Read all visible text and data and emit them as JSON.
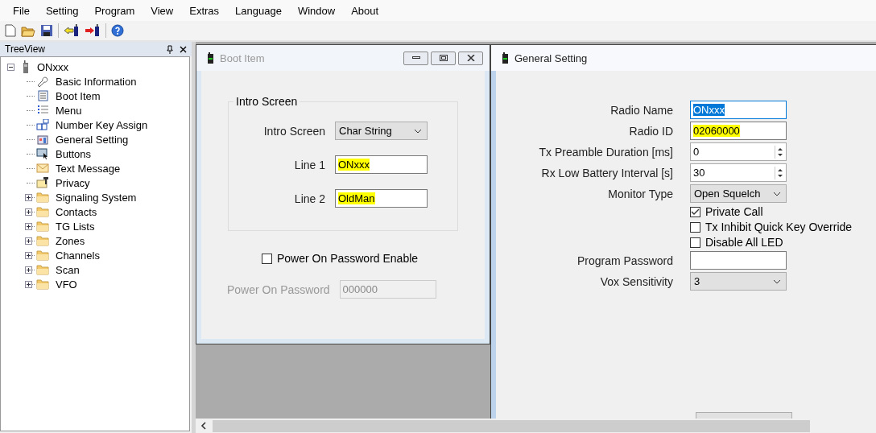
{
  "menu": [
    "File",
    "Setting",
    "Program",
    "View",
    "Extras",
    "Language",
    "Window",
    "About"
  ],
  "treeview": {
    "title": "TreeView",
    "root": {
      "label": "ONxxx",
      "expanded": true,
      "children": [
        {
          "label": "Basic Information"
        },
        {
          "label": "Boot Item"
        },
        {
          "label": "Menu"
        },
        {
          "label": "Number Key Assign"
        },
        {
          "label": "General Setting"
        },
        {
          "label": "Buttons"
        },
        {
          "label": "Text Message"
        },
        {
          "label": "Privacy"
        },
        {
          "label": "Signaling System",
          "expanded": false
        },
        {
          "label": "Contacts",
          "expanded": false
        },
        {
          "label": "TG Lists",
          "expanded": false
        },
        {
          "label": "Zones",
          "expanded": false
        },
        {
          "label": "Channels",
          "expanded": false
        },
        {
          "label": "Scan",
          "expanded": false
        },
        {
          "label": "VFO",
          "expanded": false
        }
      ]
    }
  },
  "boot_window": {
    "title": "Boot Item",
    "active": false,
    "group": {
      "title": "Intro Screen",
      "rows": [
        {
          "kind": "select",
          "label": "Intro Screen",
          "value": "Char String"
        },
        {
          "kind": "text",
          "label": "Line 1",
          "value": "ONxxx",
          "highlighted": true
        },
        {
          "kind": "text",
          "label": "Line 2",
          "value": "OldMan",
          "highlighted": true
        }
      ]
    },
    "checkbox": {
      "label": "Power On Password Enable",
      "checked": false
    },
    "password": {
      "label": "Power On Password",
      "value": "000000",
      "disabled": true
    }
  },
  "general_window": {
    "title": "General Setting",
    "active": true,
    "rows": [
      {
        "kind": "text",
        "label": "Radio Name",
        "value": "ONxxx",
        "selected": true
      },
      {
        "kind": "text",
        "label": "Radio ID",
        "value": "02060000",
        "highlighted": true
      },
      {
        "kind": "spin",
        "label": "Tx Preamble Duration [ms]",
        "value": "0"
      },
      {
        "kind": "spin",
        "label": "Rx Low Battery Interval [s]",
        "value": "30"
      },
      {
        "kind": "select",
        "label": "Monitor Type",
        "value": "Open Squelch"
      },
      {
        "kind": "checkbox",
        "label": "Private Call",
        "checked": true
      },
      {
        "kind": "checkbox",
        "label": "Tx Inhibit Quick Key Override",
        "checked": false
      },
      {
        "kind": "checkbox",
        "label": "Disable All LED",
        "checked": false
      },
      {
        "kind": "text",
        "label": "Program Password"
      },
      {
        "kind": "select",
        "label": "Vox Sensitivity",
        "value": "3"
      }
    ]
  }
}
